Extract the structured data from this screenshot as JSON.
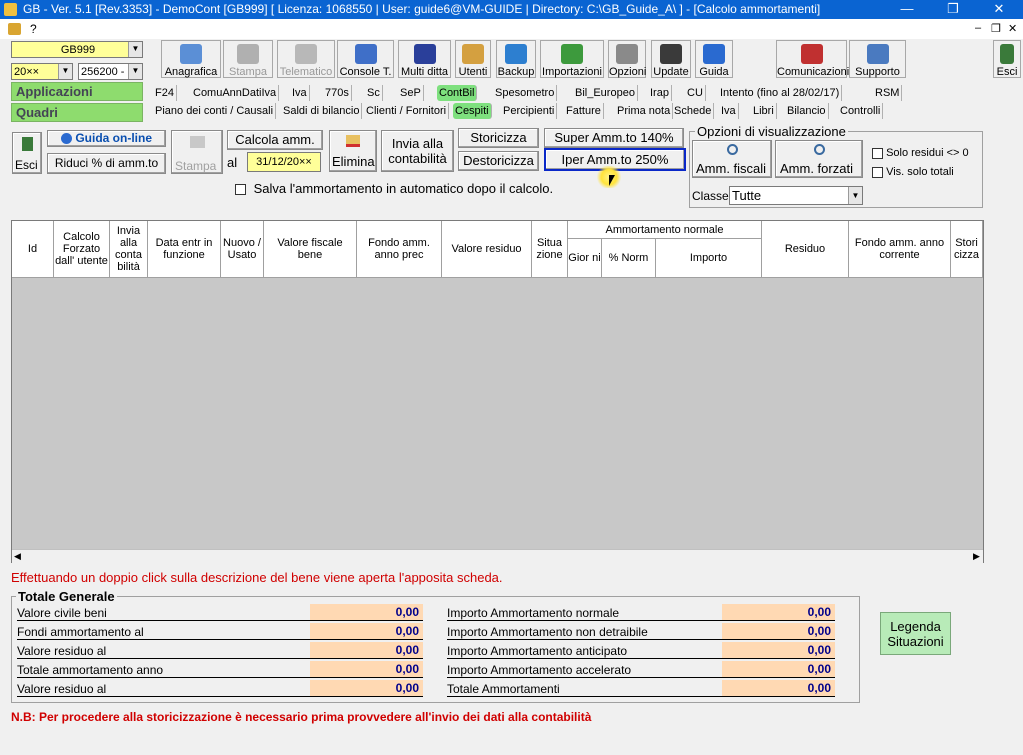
{
  "window": {
    "title": "GB - Ver. 5.1 [Rev.3353] -  DemoCont [GB999]     [ Licenza: 1068550 | User: guide6@VM-GUIDE | Directory: C:\\GB_Guide_A\\ ] - [Calcolo ammortamenti]",
    "minimize": "—",
    "restore": "❐",
    "close": "✕"
  },
  "menubar": {
    "help": "?"
  },
  "left": {
    "company": "GB999",
    "year": "20××",
    "code": "256200 -",
    "applicazioni": "Applicazioni",
    "quadri": "Quadri"
  },
  "toolbar": [
    {
      "name": "anagrafica",
      "label": "Anagrafica",
      "color": "#5b8fd6"
    },
    {
      "name": "stampa",
      "label": "Stampa",
      "color": "#b0b0b0"
    },
    {
      "name": "telematico",
      "label": "Telematico",
      "color": "#b8b8b8"
    },
    {
      "name": "console",
      "label": "Console T.",
      "color": "#3f6fc8"
    },
    {
      "name": "multi-ditta",
      "label": "Multi ditta",
      "color": "#2a3f9a"
    },
    {
      "name": "utenti",
      "label": "Utenti",
      "color": "#d4a040"
    },
    {
      "name": "backup",
      "label": "Backup",
      "color": "#2d7fd0"
    },
    {
      "name": "importazioni",
      "label": "Importazioni",
      "color": "#3d9a3d"
    },
    {
      "name": "opzioni",
      "label": "Opzioni",
      "color": "#8a8a8a"
    },
    {
      "name": "update",
      "label": "Update",
      "color": "#3a3a3a"
    },
    {
      "name": "guida",
      "label": "Guida",
      "color": "#2a6ad0"
    },
    {
      "name": "comunicazioni",
      "label": "Comunicazioni",
      "color": "#c03030"
    },
    {
      "name": "supporto",
      "label": "Supporto",
      "color": "#4a7ac0"
    }
  ],
  "esci_top": "Esci",
  "tabs_row1": [
    "F24",
    "ComuAnnDatiIva",
    "Iva",
    "770s",
    "Sc",
    "SeP",
    "ContBil",
    "Spesometro",
    "Bil_Europeo",
    "Irap",
    "CU",
    "Intento (fino al 28/02/17)",
    "RSM"
  ],
  "tabs_row2": [
    "Piano dei conti / Causali",
    "Saldi di bilancio",
    "Clienti / Fornitori",
    "Cespiti",
    "Percipienti",
    "Fatture",
    "Prima nota",
    "Schede",
    "Iva",
    "Libri",
    "Bilancio",
    "Controlli"
  ],
  "actions": {
    "esci": "Esci",
    "guida_online": "Guida on-line",
    "riduci": "Riduci % di amm.to",
    "stampa": "Stampa",
    "calcola": "Calcola amm.",
    "al": "al",
    "date": "31/12/20××",
    "elimina": "Elimina",
    "invia": "Invia alla contabilità",
    "storicizza": "Storicizza",
    "destoricizza": "Destoricizza",
    "super": "Super Amm.to 140%",
    "iper": "Iper Amm.to 250%",
    "salva_auto": "Salva l'ammortamento in automatico dopo il calcolo."
  },
  "options": {
    "title": "Opzioni di visualizzazione",
    "amm_fiscali": "Amm. fiscali",
    "amm_forzati": "Amm. forzati",
    "solo_residui": "Solo residui <> 0",
    "vis_totali": "Vis. solo totali",
    "classe_label": "Classe",
    "classe_value": "Tutte"
  },
  "table": {
    "group_header": "Ammortamento normale",
    "columns": [
      "Id",
      "Calcolo Forzato dall' utente",
      "Invia alla conta bilità",
      "Data entr in funzione",
      "Nuovo / Usato",
      "Valore fiscale bene",
      "Fondo amm. anno prec",
      "Valore residuo",
      "Situa zione",
      "Gior ni",
      "% Norm",
      "Importo",
      "Residuo",
      "Fondo amm. anno corrente",
      "Stori cizza"
    ]
  },
  "hint": "Effettuando un doppio click sulla descrizione del bene viene aperta l'apposita scheda.",
  "totals": {
    "title": "Totale Generale",
    "left": [
      {
        "label": "Valore civile beni",
        "value": "0,00"
      },
      {
        "label": "Fondi ammortamento al",
        "value": "0,00"
      },
      {
        "label": "Valore residuo al",
        "value": "0,00"
      },
      {
        "label": "Totale ammortamento anno",
        "value": "0,00"
      },
      {
        "label": "Valore residuo al",
        "value": "0,00"
      }
    ],
    "right": [
      {
        "label": "Importo Ammortamento normale",
        "value": "0,00"
      },
      {
        "label": "Importo Ammortamento non detraibile",
        "value": "0,00"
      },
      {
        "label": "Importo Ammortamento anticipato",
        "value": "0,00"
      },
      {
        "label": "Importo Ammortamento accelerato",
        "value": "0,00"
      },
      {
        "label": "Totale Ammortamenti",
        "value": "0,00"
      }
    ]
  },
  "legenda": "Legenda Situazioni",
  "note": "N.B: Per procedere alla storicizzazione è necessario prima provvedere all'invio dei dati alla contabilità"
}
